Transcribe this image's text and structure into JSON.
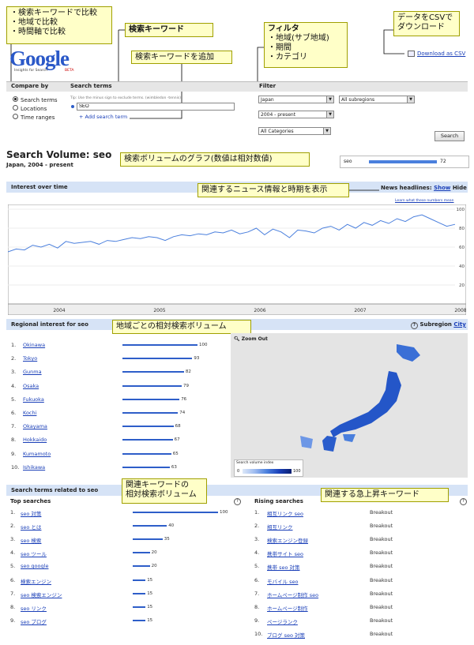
{
  "annotations": {
    "compare": [
      "・検索キーワードで比較",
      "・地域で比較",
      "・時間軸で比較"
    ],
    "keyword": "検索キーワード",
    "add_keyword": "検索キーワードを追加",
    "filter_title": "フィルタ",
    "filter_items": [
      "・地域(サブ地域)",
      "・期間",
      "・カテゴリ"
    ],
    "csv": [
      "データをCSVで",
      "ダウンロード"
    ],
    "graph": "検索ボリュームのグラフ(数値は相対数値)",
    "news": "関連するニュース情報と時期を表示",
    "regional": "地域ごとの相対検索ボリューム",
    "related": [
      "関連キーワードの",
      "相対検索ボリューム"
    ],
    "rising": "関連する急上昇キーワード"
  },
  "logo": {
    "text": "Google",
    "sub": "Insights for Search",
    "beta": "BETA"
  },
  "download": "Download as CSV",
  "compare": {
    "label": "Compare by",
    "options": [
      "Search terms",
      "Locations",
      "Time ranges"
    ],
    "selected": 0
  },
  "search_terms": {
    "label": "Search terms",
    "tip": "Tip: Use the minus sign to exclude terms. (wimbledon -tennis)",
    "value": "SEO",
    "add_link": "+ Add search term"
  },
  "filter": {
    "label": "Filter",
    "country": "Japan",
    "subregion": "All subregions",
    "period": "2004 - present",
    "category": "All Categories",
    "search_button": "Search"
  },
  "volume": {
    "title": "Search Volume: seo",
    "subtitle": "Japan, 2004 - present",
    "legend_term": "seo",
    "legend_value": "72"
  },
  "interest": {
    "header": "Interest over time",
    "news_label": "News headlines:",
    "news_show": "Show",
    "news_hide": "Hide",
    "learn": "Learn what these numbers mean"
  },
  "chart_data": {
    "type": "line",
    "x": [
      "2004",
      "2005",
      "2006",
      "2007",
      "2008"
    ],
    "yticks": [
      0,
      20,
      40,
      60,
      80,
      100
    ],
    "ylim": [
      0,
      100
    ],
    "series": [
      {
        "values": [
          55,
          58,
          57,
          62,
          60,
          63,
          59,
          66,
          64,
          65,
          66,
          63,
          67,
          66,
          68,
          70,
          69,
          71,
          70,
          67,
          71,
          73,
          72,
          74,
          73,
          76,
          75,
          78,
          74,
          76,
          80,
          73,
          79,
          76,
          70,
          78,
          77,
          75,
          80,
          82,
          78,
          84,
          80,
          86,
          83,
          88,
          85,
          90,
          87,
          92,
          94,
          90,
          86,
          82,
          84
        ]
      }
    ]
  },
  "regional": {
    "header": "Regional interest for seo",
    "subregion_label": "Subregion",
    "subregion_link": "City",
    "zoom": "Zoom Out",
    "rows": [
      {
        "rank": "1.",
        "name": "Okinawa",
        "value": 100
      },
      {
        "rank": "2.",
        "name": "Tokyo",
        "value": 93
      },
      {
        "rank": "3.",
        "name": "Gunma",
        "value": 82
      },
      {
        "rank": "4.",
        "name": "Osaka",
        "value": 79
      },
      {
        "rank": "5.",
        "name": "Fukuoka",
        "value": 76
      },
      {
        "rank": "6.",
        "name": "Kochi",
        "value": 74
      },
      {
        "rank": "7.",
        "name": "Okayama",
        "value": 68
      },
      {
        "rank": "8.",
        "name": "Hokkaido",
        "value": 67
      },
      {
        "rank": "9.",
        "name": "Kumamoto",
        "value": 65
      },
      {
        "rank": "10.",
        "name": "Ishikawa",
        "value": 63
      }
    ],
    "legend_title": "Search volume index",
    "legend_min": "0",
    "legend_max": "100"
  },
  "related": {
    "header": "Search terms related to seo",
    "top_label": "Top searches",
    "rising_label": "Rising searches",
    "top": [
      {
        "rank": "1.",
        "term": "seo 対策",
        "value": 100
      },
      {
        "rank": "2.",
        "term": "seo とは",
        "value": 40
      },
      {
        "rank": "3.",
        "term": "seo 検索",
        "value": 35
      },
      {
        "rank": "4.",
        "term": "seo ツール",
        "value": 20
      },
      {
        "rank": "5.",
        "term": "seo google",
        "value": 20
      },
      {
        "rank": "6.",
        "term": "検索エンジン",
        "value": 15
      },
      {
        "rank": "7.",
        "term": "seo 検索エンジン",
        "value": 15
      },
      {
        "rank": "8.",
        "term": "seo リンク",
        "value": 15
      },
      {
        "rank": "9.",
        "term": "seo ブログ",
        "value": 15
      }
    ],
    "rising": [
      {
        "rank": "1.",
        "term": "相互リンク seo",
        "value": "Breakout"
      },
      {
        "rank": "2.",
        "term": "相互リンク",
        "value": "Breakout"
      },
      {
        "rank": "3.",
        "term": "検索エンジン登録",
        "value": "Breakout"
      },
      {
        "rank": "4.",
        "term": "携帯サイト seo",
        "value": "Breakout"
      },
      {
        "rank": "5.",
        "term": "携帯 seo 対策",
        "value": "Breakout"
      },
      {
        "rank": "6.",
        "term": "モバイル seo",
        "value": "Breakout"
      },
      {
        "rank": "7.",
        "term": "ホームページ制作 seo",
        "value": "Breakout"
      },
      {
        "rank": "8.",
        "term": "ホームページ制作",
        "value": "Breakout"
      },
      {
        "rank": "9.",
        "term": "ページランク",
        "value": "Breakout"
      },
      {
        "rank": "10.",
        "term": "ブログ seo 対策",
        "value": "Breakout"
      }
    ]
  }
}
